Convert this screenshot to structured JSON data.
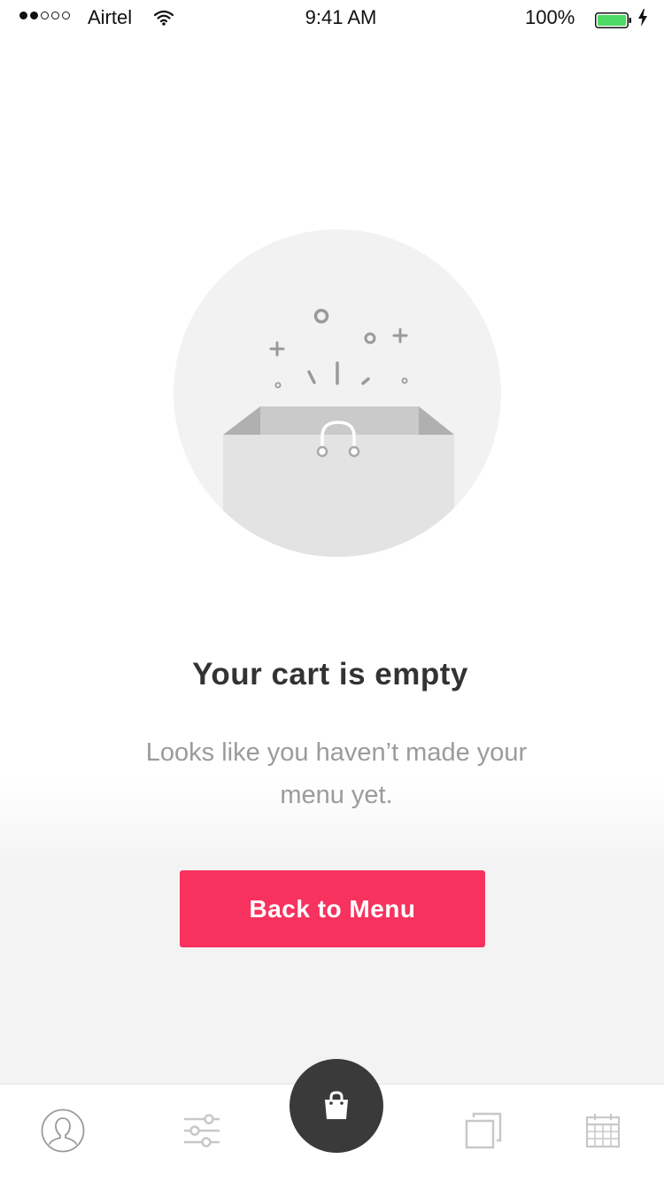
{
  "status_bar": {
    "carrier": "Airtel",
    "time": "9:41 AM",
    "battery": "100%",
    "signal_bars": 2,
    "signal_total": 5
  },
  "empty_state": {
    "title": "Your cart is empty",
    "message": "Looks like you haven’t made your menu yet.",
    "illustration": "shopping-bag-illustration"
  },
  "actions": {
    "back_to_menu": "Back to Menu"
  },
  "tab_bar": {
    "tabs": [
      {
        "icon": "profile-icon"
      },
      {
        "icon": "filters-icon"
      },
      {
        "icon": "cart-bag-icon",
        "active": true
      },
      {
        "icon": "cards-icon"
      },
      {
        "icon": "calendar-icon"
      }
    ]
  },
  "colors": {
    "accent": "#f7325e",
    "fab": "#3a3a3a",
    "battery": "#4cd964",
    "title": "#333333",
    "muted": "#9b9b9b"
  }
}
